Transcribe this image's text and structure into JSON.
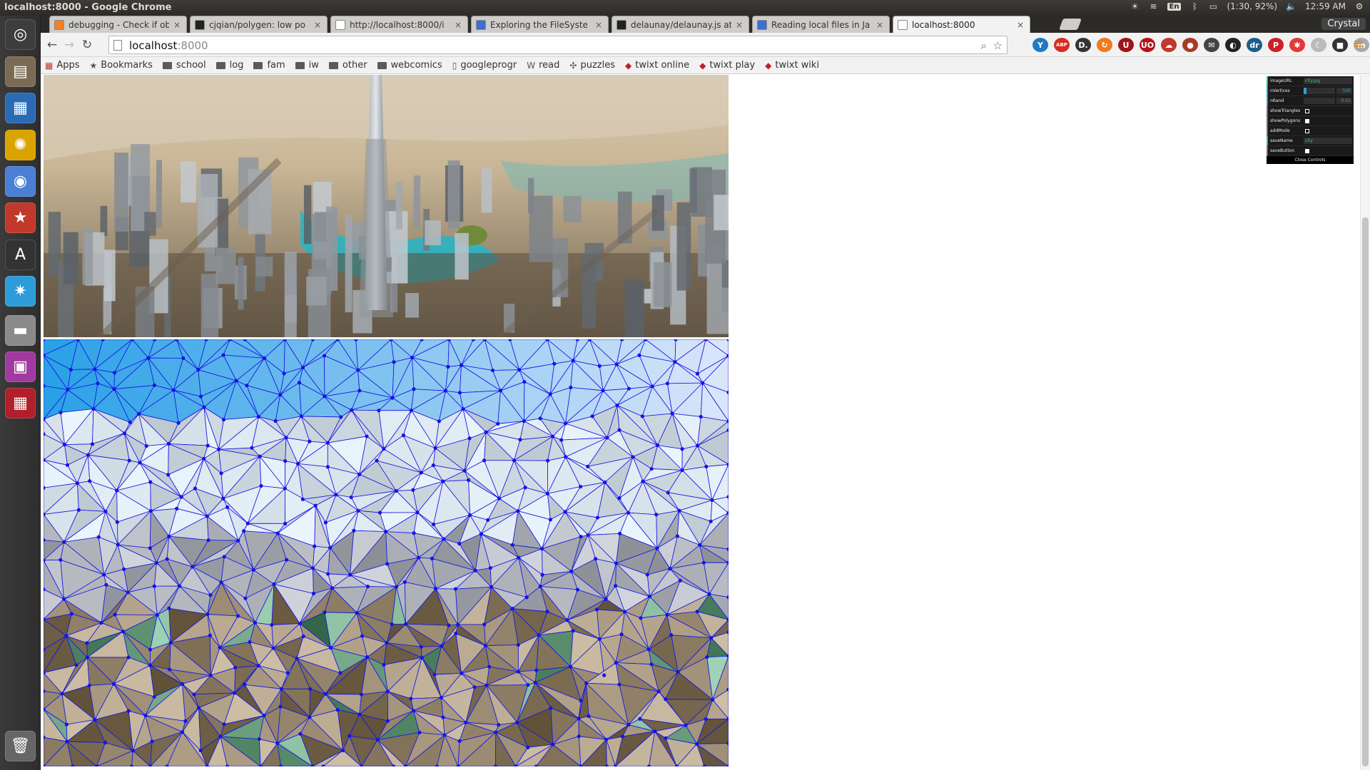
{
  "window": {
    "title": "localhost:8000 - Google Chrome"
  },
  "tray": {
    "lang": "En",
    "battery": "(1:30, 92%)",
    "clock": "12:59 AM"
  },
  "tabs": [
    {
      "title": "debugging - Check if ob",
      "favicon": "stackoverflow-icon",
      "fav_color": "#f48024",
      "active": false
    },
    {
      "title": "cjqian/polygen: low po",
      "favicon": "github-icon",
      "fav_color": "#222222",
      "active": false
    },
    {
      "title": "http://localhost:8000/i",
      "favicon": "page-icon",
      "fav_color": "#ffffff",
      "active": false
    },
    {
      "title": "Exploring the FileSyste",
      "favicon": "html5-icon",
      "fav_color": "#3c6fd1",
      "active": false
    },
    {
      "title": "delaunay/delaunay.js at",
      "favicon": "github-icon",
      "fav_color": "#222222",
      "active": false
    },
    {
      "title": "Reading local files in Ja",
      "favicon": "html5-icon",
      "fav_color": "#3c6fd1",
      "active": false
    },
    {
      "title": "localhost:8000",
      "favicon": "page-icon",
      "fav_color": "#ffffff",
      "active": true
    }
  ],
  "profile": "Crystal",
  "omnibox": {
    "host": "localhost",
    "port": ":8000"
  },
  "bookmarks": [
    {
      "label": "Apps",
      "icon": "apps-grid-icon"
    },
    {
      "label": "Bookmarks",
      "icon": "star-icon"
    },
    {
      "label": "school",
      "icon": "folder-icon"
    },
    {
      "label": "log",
      "icon": "folder-icon"
    },
    {
      "label": "fam",
      "icon": "folder-icon"
    },
    {
      "label": "iw",
      "icon": "folder-icon"
    },
    {
      "label": "other",
      "icon": "folder-icon"
    },
    {
      "label": "webcomics",
      "icon": "folder-icon"
    },
    {
      "label": "googleprogr",
      "icon": "page-icon"
    },
    {
      "label": "read",
      "icon": "wikipedia-icon"
    },
    {
      "label": "puzzles",
      "icon": "puzzle-icon"
    },
    {
      "label": "twixt online",
      "icon": "twixt-icon"
    },
    {
      "label": "twixt play",
      "icon": "twixt-icon"
    },
    {
      "label": "twixt wiki",
      "icon": "twixt-icon"
    }
  ],
  "extensions": [
    {
      "name": "v-icon",
      "color": "#1f7ac2",
      "glyph": "Y"
    },
    {
      "name": "adblock-icon",
      "color": "#d62d20",
      "glyph": "ABP"
    },
    {
      "name": "d-icon",
      "color": "#333333",
      "glyph": "D."
    },
    {
      "name": "refresh-ext-icon",
      "color": "#f07a1c",
      "glyph": "↻"
    },
    {
      "name": "ublock-icon",
      "color": "#a0141c",
      "glyph": "U"
    },
    {
      "name": "shield-icon",
      "color": "#b5121b",
      "glyph": "UO"
    },
    {
      "name": "cloud-icon",
      "color": "#c0392b",
      "glyph": "☁"
    },
    {
      "name": "apple-icon",
      "color": "#a83a2a",
      "glyph": "●"
    },
    {
      "name": "mail-icon",
      "color": "#444444",
      "glyph": "✉"
    },
    {
      "name": "contrast-icon",
      "color": "#222222",
      "glyph": "◐"
    },
    {
      "name": "tool-icon",
      "color": "#1a5f8a",
      "glyph": "dr"
    },
    {
      "name": "pinterest-icon",
      "color": "#cb2027",
      "glyph": "P"
    },
    {
      "name": "asterisk-icon",
      "color": "#e03a3a",
      "glyph": "✱"
    },
    {
      "name": "moon-icon",
      "color": "#bbbbbb",
      "glyph": "☾"
    },
    {
      "name": "square-icon",
      "color": "#333333",
      "glyph": "■"
    },
    {
      "name": "m-icon",
      "color": "#aaaaaa",
      "glyph": "m"
    }
  ],
  "launcher": [
    {
      "name": "dash-icon",
      "color": "#3d3d3d",
      "glyph": "◎"
    },
    {
      "name": "files-icon",
      "color": "#7b6b55",
      "glyph": "▤"
    },
    {
      "name": "writer-icon",
      "color": "#2a6bb6",
      "glyph": "▦"
    },
    {
      "name": "bulb-icon",
      "color": "#d9a300",
      "glyph": "✺"
    },
    {
      "name": "chrome-icon",
      "color": "#4a7fd4",
      "glyph": "◉"
    },
    {
      "name": "star-app-icon",
      "color": "#c0392b",
      "glyph": "★"
    },
    {
      "name": "software-center-icon",
      "color": "#333333",
      "glyph": "A"
    },
    {
      "name": "snowflake-icon",
      "color": "#2e9cd8",
      "glyph": "✷"
    },
    {
      "name": "drive-icon",
      "color": "#8a8a8a",
      "glyph": "▬"
    },
    {
      "name": "media-icon",
      "color": "#a03aa0",
      "glyph": "▣"
    },
    {
      "name": "workspace-icon",
      "color": "#b0202a",
      "glyph": "▦"
    },
    {
      "name": "trash-icon",
      "color": "#666666",
      "glyph": "🗑"
    }
  ],
  "controls": {
    "imageURL": {
      "label": "imageURL",
      "value": "city.jpg"
    },
    "nVertices": {
      "label": "nVertices",
      "value": "500",
      "fraction": 0.1
    },
    "nRand": {
      "label": "nRand",
      "value": "0.01",
      "fraction": 0.0
    },
    "showTriangles": {
      "label": "showTriangles",
      "checked": true
    },
    "showPolygons": {
      "label": "showPolygons",
      "checked": false
    },
    "addMode": {
      "label": "addMode",
      "checked": true
    },
    "saveName": {
      "label": "saveName",
      "value": "city"
    },
    "saveButton": {
      "label": "saveButton",
      "checked": false
    },
    "close_label": "Close Controls"
  },
  "colors": {
    "mesh_edges": "#1414e6",
    "chrome_accent": "#e08a00"
  }
}
